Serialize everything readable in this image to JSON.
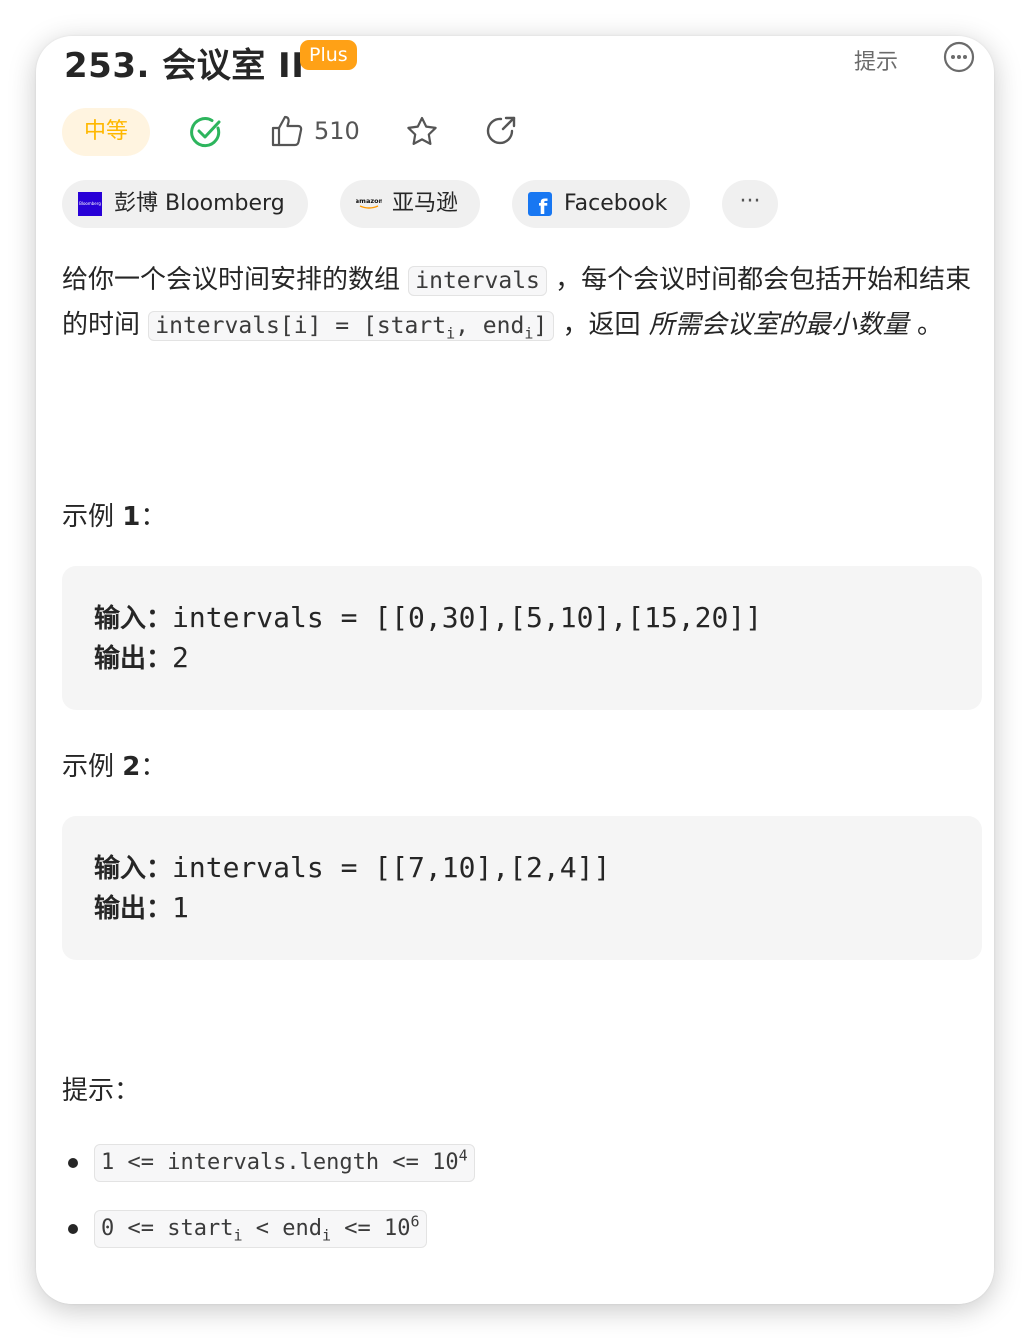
{
  "header": {
    "title": "253. 会议室 II",
    "plus_badge": "Plus",
    "hint_link": "提示"
  },
  "meta": {
    "difficulty": "中等",
    "like_count": "510"
  },
  "tags": {
    "bloomberg": "彭博 Bloomberg",
    "bloomberg_logo_text": "Bloomberg",
    "amazon": "亚马逊",
    "amazon_logo_text": "amazon",
    "facebook": "Facebook",
    "facebook_logo_text": "f",
    "more": "···"
  },
  "description": {
    "part1": "给你一个会议时间安排的数组 ",
    "code1": "intervals",
    "part2": " ，每个会议时间都会包括开始和结束的时间 ",
    "code2_a": "intervals[i] = [start",
    "code2_sub1": "i",
    "code2_b": ", end",
    "code2_sub2": "i",
    "code2_c": "]",
    "part3": " ，返回 ",
    "emphasis": "所需会议室的最小数量",
    "part4": " 。"
  },
  "examples": [
    {
      "title_prefix": "示例 ",
      "title_num": "1",
      "title_suffix": "：",
      "input_label": "输入：",
      "input_value": "intervals = [[0,30],[5,10],[15,20]]",
      "output_label": "输出：",
      "output_value": "2"
    },
    {
      "title_prefix": "示例 ",
      "title_num": "2",
      "title_suffix": "：",
      "input_label": "输入：",
      "input_value": "intervals = [[7,10],[2,4]]",
      "output_label": "输出：",
      "output_value": "1"
    }
  ],
  "hints": {
    "title": "提示：",
    "items": [
      {
        "text": "1 <= intervals.length <= 10",
        "sup": "4"
      },
      {
        "a": "0 <= start",
        "sub1": "i",
        "b": " < end",
        "sub2": "i",
        "c": " <= 10",
        "sup": "6"
      }
    ]
  },
  "colors": {
    "accent": "#ffa116",
    "medium": "#ffb800",
    "solved": "#2db55d",
    "facebook": "#1877f2",
    "bloomberg": "#2800d7"
  }
}
